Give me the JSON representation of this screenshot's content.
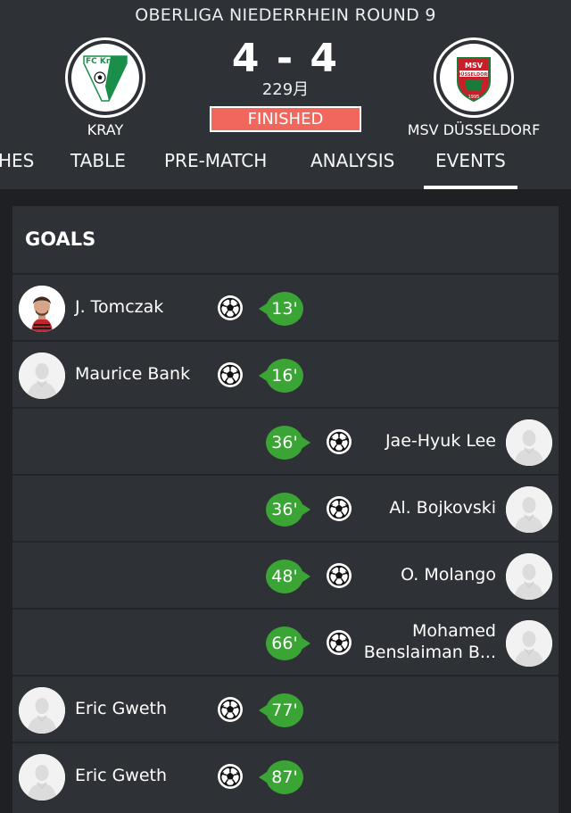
{
  "header": {
    "league_round": "OBERLIGA  NIEDERRHEIN ROUND 9",
    "score": "4 - 4",
    "date": "229月",
    "status": "FINISHED",
    "status_color": "#f1675e",
    "home_team": {
      "name": "KRAY",
      "logo_text": "FC Kray"
    },
    "away_team": {
      "name": "MSV DÜSSELDORF",
      "logo_text": "MSV DÜSSELDORF",
      "logo_year": "1995"
    }
  },
  "tabs": [
    {
      "label": "HES"
    },
    {
      "label": "TABLE"
    },
    {
      "label": "PRE-MATCH"
    },
    {
      "label": "ANALYSIS"
    },
    {
      "label": "EVENTS",
      "active": true
    }
  ],
  "goals": {
    "title": "GOALS",
    "accent_color": "#3aa535",
    "events": [
      {
        "side": "home",
        "player": "J. Tomczak",
        "minute": "13'",
        "photo": "real"
      },
      {
        "side": "home",
        "player": "Maurice Bank",
        "minute": "16'",
        "photo": "placeholder"
      },
      {
        "side": "away",
        "player": "Jae-Hyuk Lee",
        "minute": "36'",
        "photo": "placeholder"
      },
      {
        "side": "away",
        "player": "Al. Bojkovski",
        "minute": "36'",
        "photo": "placeholder"
      },
      {
        "side": "away",
        "player": "O. Molango",
        "minute": "48'",
        "photo": "placeholder"
      },
      {
        "side": "away",
        "player_line1": "Mohamed",
        "player_line2": "Benslaiman B...",
        "minute": "66'",
        "photo": "placeholder"
      },
      {
        "side": "home",
        "player": "Eric Gweth",
        "minute": "77'",
        "photo": "placeholder"
      },
      {
        "side": "home",
        "player": "Eric Gweth",
        "minute": "87'",
        "photo": "placeholder"
      }
    ]
  },
  "icons": [
    "soccer-ball-icon",
    "player-placeholder-icon",
    "player-photo"
  ]
}
